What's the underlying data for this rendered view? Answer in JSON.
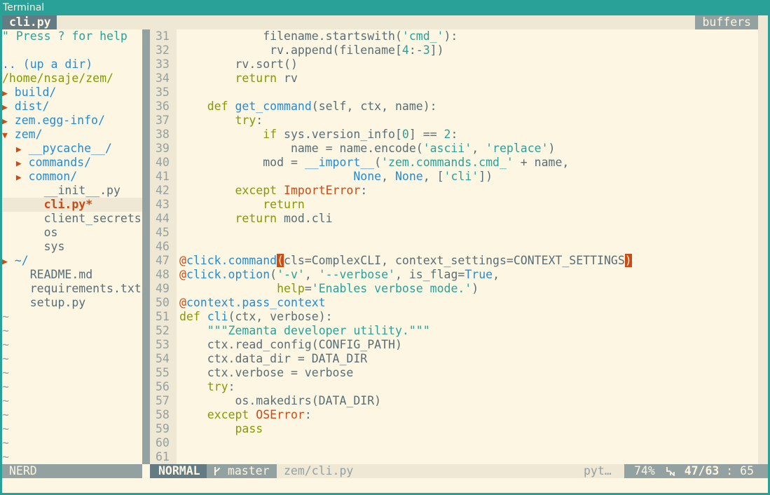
{
  "window": {
    "title": "Terminal"
  },
  "tabline": {
    "active_tab": "cli.py",
    "buffers_label": "buffers"
  },
  "nerdtree": {
    "help": "\" Press ? for help",
    "updir": ".. (up a dir)",
    "root": "/home/nsaje/zem/",
    "entries": [
      {
        "indent": "",
        "arrow": "▶",
        "name": "build/",
        "kind": "dir"
      },
      {
        "indent": "",
        "arrow": "▶",
        "name": "dist/",
        "kind": "dir"
      },
      {
        "indent": "",
        "arrow": "▶",
        "name": "zem.egg-info/",
        "kind": "dir"
      },
      {
        "indent": "",
        "arrow": "▼",
        "name": "zem/",
        "kind": "dir"
      },
      {
        "indent": "  ",
        "arrow": "▶",
        "name": "__pycache__/",
        "kind": "dir"
      },
      {
        "indent": "  ",
        "arrow": "▶",
        "name": "commands/",
        "kind": "dir"
      },
      {
        "indent": "  ",
        "arrow": "▶",
        "name": "common/",
        "kind": "dir"
      },
      {
        "indent": "    ",
        "arrow": "",
        "name": "__init__.py",
        "kind": "file"
      },
      {
        "indent": "    ",
        "arrow": "",
        "name": "cli.py*",
        "kind": "current"
      },
      {
        "indent": "    ",
        "arrow": "",
        "name": "client_secrets.j",
        "kind": "file"
      },
      {
        "indent": "    ",
        "arrow": "",
        "name": "os",
        "kind": "file"
      },
      {
        "indent": "    ",
        "arrow": "",
        "name": "sys",
        "kind": "file"
      },
      {
        "indent": "",
        "arrow": "▶",
        "name": "~/",
        "kind": "dir"
      },
      {
        "indent": "  ",
        "arrow": "",
        "name": "README.md",
        "kind": "file"
      },
      {
        "indent": "  ",
        "arrow": "",
        "name": "requirements.txt",
        "kind": "file"
      },
      {
        "indent": "  ",
        "arrow": "",
        "name": "setup.py",
        "kind": "file"
      }
    ],
    "tilde_count": 11,
    "tilde": "~"
  },
  "editor": {
    "lines": [
      {
        "n": "31",
        "t": [
          [
            "            filename.startswith(",
            ""
          ],
          [
            "'cmd_'",
            "str"
          ],
          [
            "):",
            ""
          ]
        ]
      },
      {
        "n": "32",
        "t": [
          [
            "             rv.append(filename[",
            ""
          ],
          [
            "4",
            "num"
          ],
          [
            ":-",
            ""
          ],
          [
            "3",
            "num"
          ],
          [
            "])",
            ""
          ]
        ]
      },
      {
        "n": "33",
        "t": [
          [
            "        rv.sort()",
            ""
          ]
        ]
      },
      {
        "n": "34",
        "t": [
          [
            "        ",
            ""
          ],
          [
            "return",
            "kw"
          ],
          [
            " rv",
            ""
          ]
        ]
      },
      {
        "n": "35",
        "t": []
      },
      {
        "n": "36",
        "t": [
          [
            "    ",
            ""
          ],
          [
            "def",
            "kw"
          ],
          [
            " ",
            ""
          ],
          [
            "get_command",
            "fn"
          ],
          [
            "(self, ctx, name):",
            ""
          ]
        ]
      },
      {
        "n": "37",
        "t": [
          [
            "        ",
            ""
          ],
          [
            "try",
            "kw"
          ],
          [
            ":",
            ""
          ]
        ]
      },
      {
        "n": "38",
        "t": [
          [
            "            ",
            ""
          ],
          [
            "if",
            "kw"
          ],
          [
            " sys.version_info[",
            ""
          ],
          [
            "0",
            "num"
          ],
          [
            "] == ",
            ""
          ],
          [
            "2",
            "num"
          ],
          [
            ":",
            ""
          ]
        ]
      },
      {
        "n": "39",
        "t": [
          [
            "                name = name.encode(",
            ""
          ],
          [
            "'ascii'",
            "str"
          ],
          [
            ", ",
            ""
          ],
          [
            "'replace'",
            "str"
          ],
          [
            ")",
            ""
          ]
        ]
      },
      {
        "n": "40",
        "t": [
          [
            "            mod = ",
            ""
          ],
          [
            "__import__",
            "fn"
          ],
          [
            "(",
            ""
          ],
          [
            "'zem.commands.cmd_'",
            "str"
          ],
          [
            " + name,",
            ""
          ]
        ]
      },
      {
        "n": "41",
        "t": [
          [
            "                         ",
            ""
          ],
          [
            "None",
            "const"
          ],
          [
            ", ",
            ""
          ],
          [
            "None",
            "const"
          ],
          [
            ", [",
            ""
          ],
          [
            "'cli'",
            "str"
          ],
          [
            "])",
            ""
          ]
        ]
      },
      {
        "n": "42",
        "t": [
          [
            "        ",
            ""
          ],
          [
            "except",
            "kw"
          ],
          [
            " ",
            ""
          ],
          [
            "ImportError",
            "exc"
          ],
          [
            ":",
            ""
          ]
        ]
      },
      {
        "n": "43",
        "t": [
          [
            "            ",
            ""
          ],
          [
            "return",
            "kw"
          ]
        ]
      },
      {
        "n": "44",
        "t": [
          [
            "        ",
            ""
          ],
          [
            "return",
            "kw"
          ],
          [
            " mod.cli",
            ""
          ]
        ]
      },
      {
        "n": "45",
        "t": []
      },
      {
        "n": "46",
        "t": []
      },
      {
        "n": "47",
        "t": [
          [
            "@",
            "dec"
          ],
          [
            "click.command",
            "decname"
          ],
          [
            "(",
            "paren-match"
          ],
          [
            "cls=ComplexCLI, context_settings=CONTEXT_SETTINGS",
            ""
          ],
          [
            ")",
            "paren-match"
          ]
        ]
      },
      {
        "n": "48",
        "t": [
          [
            "@",
            "dec"
          ],
          [
            "click.option",
            "decname"
          ],
          [
            "(",
            ""
          ],
          [
            "'-v'",
            "str"
          ],
          [
            ", ",
            ""
          ],
          [
            "'--verbose'",
            "str"
          ],
          [
            ", is_flag=",
            ""
          ],
          [
            "True",
            "const"
          ],
          [
            ",",
            ""
          ]
        ]
      },
      {
        "n": "49",
        "t": [
          [
            "              ",
            ""
          ],
          [
            "help",
            "kw"
          ],
          [
            "=",
            ""
          ],
          [
            "'Enables verbose mode.'",
            "str"
          ],
          [
            ")",
            ""
          ]
        ]
      },
      {
        "n": "50",
        "t": [
          [
            "@",
            "dec"
          ],
          [
            "context.pass_context",
            "decname"
          ]
        ]
      },
      {
        "n": "51",
        "t": [
          [
            "def",
            "kw"
          ],
          [
            " ",
            ""
          ],
          [
            "cli",
            "fn"
          ],
          [
            "(ctx, verbose):",
            ""
          ]
        ]
      },
      {
        "n": "52",
        "t": [
          [
            "    ",
            ""
          ],
          [
            "\"\"\"Zemanta developer utility.\"\"\"",
            "str"
          ]
        ]
      },
      {
        "n": "53",
        "t": [
          [
            "    ctx.read_config(CONFIG_PATH)",
            ""
          ]
        ]
      },
      {
        "n": "54",
        "t": [
          [
            "    ctx.data_dir = DATA_DIR",
            ""
          ]
        ]
      },
      {
        "n": "55",
        "t": [
          [
            "    ctx.verbose = verbose",
            ""
          ]
        ]
      },
      {
        "n": "56",
        "t": [
          [
            "    ",
            ""
          ],
          [
            "try",
            "kw"
          ],
          [
            ":",
            ""
          ]
        ]
      },
      {
        "n": "57",
        "t": [
          [
            "        os.makedirs(DATA_DIR)",
            ""
          ]
        ]
      },
      {
        "n": "58",
        "t": [
          [
            "    ",
            ""
          ],
          [
            "except",
            "kw"
          ],
          [
            " ",
            ""
          ],
          [
            "OSError",
            "exc"
          ],
          [
            ":",
            ""
          ]
        ]
      },
      {
        "n": "59",
        "t": [
          [
            "        ",
            ""
          ],
          [
            "pass",
            "kw"
          ]
        ]
      },
      {
        "n": "60",
        "t": []
      },
      {
        "n": "61",
        "t": []
      }
    ]
  },
  "statusline": {
    "nerd": "NERD",
    "mode": "NORMAL",
    "branch_icon": "branch-icon",
    "branch": "master",
    "file": "zem/cli.py",
    "filetype": "pyt…",
    "percent": "74%",
    "line_icon": "line-number-icon",
    "line": "47/63",
    "sep": " : ",
    "col": "65"
  },
  "colors": {
    "background": "#fdf6e3",
    "frame": "#2aa198",
    "keyword": "#859900",
    "string": "#2aa198",
    "function": "#268bd2",
    "exception": "#cb4b16"
  }
}
